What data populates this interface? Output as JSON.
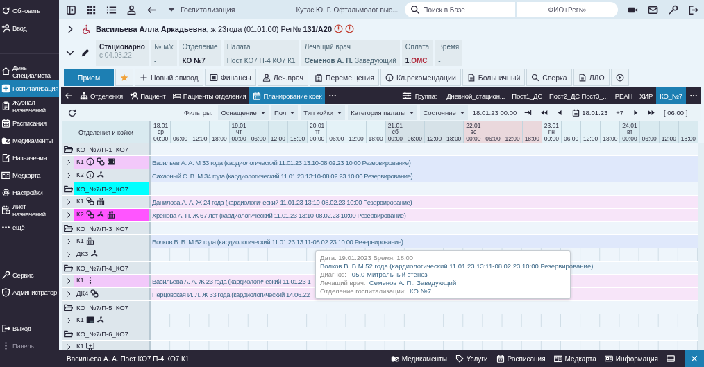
{
  "sidebar": {
    "top": [
      {
        "label": "Обновить"
      },
      {
        "label": "Ввод"
      }
    ],
    "items": [
      {
        "label": "День Специалиста",
        "selected": false
      },
      {
        "label": "Госпитализация",
        "selected": true
      },
      {
        "label": "Журнал назначений",
        "selected": false
      },
      {
        "label": "Расписания",
        "selected": false
      },
      {
        "label": "Медикаменты",
        "selected": false
      },
      {
        "label": "Назначения",
        "selected": false
      },
      {
        "label": "Медкарта",
        "selected": false
      },
      {
        "label": "Настройки",
        "selected": false
      },
      {
        "label": "Лист назначений",
        "selected": false
      },
      {
        "label": "ещё",
        "selected": false
      }
    ],
    "tools": [
      {
        "label": "Сервис"
      },
      {
        "label": "Администратор"
      }
    ],
    "bottom": [
      {
        "label": "Выход",
        "disabled": false
      },
      {
        "label": "Панель",
        "disabled": true
      }
    ]
  },
  "toolbar": {
    "module": "Госпитализация",
    "user": "Кутас Ю. Г. Офтальмолог выс...",
    "search": {
      "placeholder": "Поиск в Базе"
    },
    "patient_field": {
      "placeholder": "ФИО+Рег№"
    }
  },
  "patient": {
    "header": "**Васильева Алла Аркадьевна**, ж 23года (01.01.00) Рег№ **131/А20**"
  },
  "episode": {
    "cards": [
      {
        "kind": "type",
        "label": "Стационарно",
        "value": "с 04.03.22"
      },
      {
        "kind": "field",
        "label": "№ м/к",
        "value": "-",
        "bold": false
      },
      {
        "kind": "field",
        "label": "Отделение",
        "value": "КО №7",
        "bold": true
      },
      {
        "kind": "field",
        "label": "Палата",
        "value": "Пост КО7 П-4 КО7 К1",
        "bold": false
      },
      {
        "kind": "field",
        "label": "Лечащий врач",
        "value": "**Семенов А. П.** Заведующий",
        "bold": false
      },
      {
        "kind": "payment",
        "label": "Оплата",
        "code": "1.",
        "value": "ОМС"
      },
      {
        "kind": "field",
        "label": "Время",
        "value": "-",
        "bold": false
      }
    ]
  },
  "actions": {
    "favorite": {
      "checked": true
    },
    "buttons": [
      {
        "label": "Прием",
        "primary": true
      },
      {
        "label": "Новый эпизод",
        "primary": false
      },
      {
        "label": "Финансы",
        "primary": false
      },
      {
        "label": "Леч.врач",
        "primary": false
      },
      {
        "label": "Перемещения",
        "primary": false
      },
      {
        "label": "Кл.рекомендации",
        "primary": false
      },
      {
        "label": "Больничный",
        "primary": false
      },
      {
        "label": "Сверка",
        "primary": false
      },
      {
        "label": "ЛЛО",
        "primary": false
      }
    ]
  },
  "nav": {
    "tabs": [
      {
        "label": "Отделения",
        "selected": false
      },
      {
        "label": "Пациент",
        "selected": false
      },
      {
        "label": "Пациенты отделения",
        "selected": false
      },
      {
        "label": "Планирование коек",
        "selected": true
      }
    ],
    "group_label": "Группа:",
    "groups": [
      {
        "label": "Дневной_стацион...",
        "selected": false
      },
      {
        "label": "Пост1_ДС",
        "selected": false
      },
      {
        "label": "Пост2_ДС Пост3_...",
        "selected": false
      },
      {
        "label": "РЕАН",
        "selected": false
      },
      {
        "label": "ХИР",
        "selected": false
      },
      {
        "label": "КО_№7",
        "selected": true
      }
    ]
  },
  "filters": {
    "label": "Фильтры:",
    "dropdowns": [
      "Оснащение",
      "Пол",
      "Тип койки",
      "Категория палаты",
      "Состояние"
    ],
    "start": "18.01.23 00:00",
    "date": "18.01.23",
    "step": "+7",
    "interval": "[ 06:00 ]"
  },
  "timeline": {
    "heading": "Отделения и койки",
    "days": [
      {
        "date": "18.01",
        "weekday": "ср",
        "color": "#e4f2f7",
        "times": [
          "00:00",
          "06:00",
          "12:00",
          "18:00"
        ]
      },
      {
        "date": "19.01",
        "weekday": "чт",
        "color": "#d9eaf0",
        "times": [
          "00:00",
          "06:00",
          "12:00",
          "18:00"
        ]
      },
      {
        "date": "20.01",
        "weekday": "пт",
        "color": "#e4f2f7",
        "times": [
          "00:00",
          "06:00",
          "12:00",
          "18:00"
        ]
      },
      {
        "date": "21.01",
        "weekday": "сб",
        "color": "#d6e2e8",
        "times": [
          "00:00",
          "06:00",
          "12:00",
          "18:00"
        ]
      },
      {
        "date": "22.01",
        "weekday": "вс",
        "color": "#ead8dc",
        "times": [
          "00:00",
          "06:00",
          "12:00",
          "18:00"
        ]
      },
      {
        "date": "23.01",
        "weekday": "пн",
        "color": "#e4f2f7",
        "times": [
          "00:00",
          "06:00",
          "12:00",
          "18:00"
        ]
      },
      {
        "date": "24.01",
        "weekday": "вт",
        "color": "#d9eaf0",
        "times": [
          "00:00",
          "06:00",
          "12:00",
          "18:00"
        ]
      }
    ]
  },
  "rows": [
    {
      "kind": "group",
      "label": "КО_№7/П-1_КО7"
    },
    {
      "kind": "bed",
      "label": "К1",
      "color": "#f2c8fa",
      "equipment": [
        {
          "kind": "info"
        },
        {
          "kind": "link"
        },
        {
          "kind": "film"
        }
      ],
      "booking": {
        "text": "Васильев А. А. М 33 года (кардиологический 11.01.23 13:10-08.02.23 10:00 Резервирование)",
        "color": "#dfe8fb"
      }
    },
    {
      "kind": "bed",
      "label": "К2",
      "color": "#dde6ec",
      "equipment": [
        {
          "kind": "info"
        },
        {
          "kind": "fan"
        }
      ],
      "booking": {
        "text": "Сахарный С. В. М 34 года (кардиологический 11.01.23 13:10-08.02.23 10:00 Резервирование)",
        "color": "#dfe8fb"
      }
    },
    {
      "kind": "group",
      "label": "КО_№7/П-2_КО7",
      "color": "#00ffff"
    },
    {
      "kind": "bed",
      "label": "К1",
      "color": "#dde6ec",
      "equipment": [
        {
          "kind": "link"
        },
        {
          "kind": "radiator"
        }
      ],
      "booking": {
        "text": "Данилова А. А. Ж 24 года (кардиологический 11.01.23 13:10-08.02.23 10:00 Резервирование)",
        "color": "#f7e5f9"
      }
    },
    {
      "kind": "bed",
      "label": "К2",
      "color": "#ff55ff",
      "equipment": [
        {
          "kind": "link"
        },
        {
          "kind": "fan"
        },
        {
          "kind": "radiator"
        }
      ],
      "booking": {
        "text": "Хренова А. П. Ж 67 лет (кардиологический 11.01.23 13:10-08.02.23 10:00 Резервирование)",
        "color": "#f7e5f9"
      }
    },
    {
      "kind": "group",
      "label": "КО_№7/П-3_КО7"
    },
    {
      "kind": "bed",
      "label": "К1",
      "color": "#dde6ec",
      "equipment": [
        {
          "kind": "radiator"
        }
      ],
      "booking": {
        "text": "Волков В. В. М 52 года (кардиологический 11.01.23 13:11-08.02.23 10:00 Резервирование)",
        "color": "#dfe8fb"
      }
    },
    {
      "kind": "bed",
      "label": "ДК3",
      "color": "#dde6ec",
      "equipment": [
        {
          "kind": "fan"
        }
      ]
    },
    {
      "kind": "group",
      "label": "КО_№7/П-4_КО7"
    },
    {
      "kind": "bed",
      "label": "К1",
      "color": "#f2c8fa",
      "equipment": [
        {
          "kind": "dots"
        }
      ],
      "booking": {
        "text": "Васильева А. А. Ж 23 года (кардиологический 11.01.23 1",
        "color": "#f7e5f9"
      }
    },
    {
      "kind": "bed",
      "label": "ДК4",
      "color": "#dde6ec",
      "equipment": [
        {
          "kind": "link"
        }
      ],
      "booking": {
        "text": "Перцовская И. Л. Ж 33 года (кардиологический 14.06.22",
        "color": "#f7e5f9"
      }
    },
    {
      "kind": "group",
      "label": "КО_№7/П-5_КО7"
    },
    {
      "kind": "bed",
      "label": "К1",
      "color": "#dde6ec",
      "equipment": [
        {
          "kind": "screen"
        },
        {
          "kind": "fan"
        }
      ]
    },
    {
      "kind": "group",
      "label": "КО_№7/П-6_КО7"
    },
    {
      "kind": "bed",
      "label": "К1",
      "color": "#dde6ec",
      "equipment": [
        {
          "kind": "monitor-plus"
        }
      ]
    }
  ],
  "tooltip": {
    "lines": [
      {
        "label": "Дата: 19.01.2023 Время: 18:00"
      },
      {
        "value": "Волков В. В.М 52 года (кардиологический 11.01.23 13:11-08.02.23 10:00 Резервирование)"
      },
      {
        "label": "Диагноз:",
        "value": "I05.0 Митральный стеноз"
      },
      {
        "label": "Лечащий врач:",
        "value": "Семенов А. П., Заведующий"
      },
      {
        "label": "Отделение госпитализации:",
        "value": "КО №7"
      }
    ]
  },
  "status_bar": {
    "text": "Васильева А. А. Пост КО7 П-4 КО7 К1",
    "buttons": [
      "Медикаменты",
      "Услуги",
      "Расписания",
      "Медкарта",
      "Информация"
    ]
  }
}
